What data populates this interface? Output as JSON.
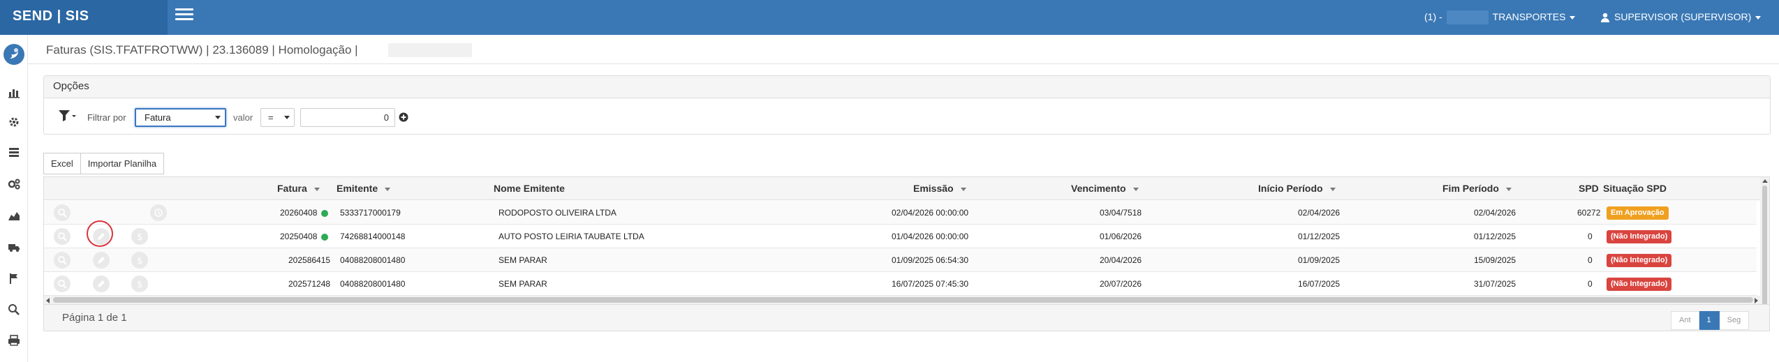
{
  "app": {
    "brand": "SEND | SIS"
  },
  "topbar": {
    "company_prefix": "(1) -",
    "company_name": "TRANSPORTES",
    "user": "SUPERVISOR (SUPERVISOR)"
  },
  "header": {
    "title": "Faturas (SIS.TFATFROTWW) | 23.136089 | Homologação |"
  },
  "options": {
    "title": "Opções",
    "filter_label": "Filtrar por",
    "filter_field": "Fatura",
    "valor_label": "valor",
    "operator": "=",
    "value": "0"
  },
  "toolbar": {
    "excel": "Excel",
    "import": "Importar Planilha"
  },
  "table": {
    "columns": [
      "Fatura",
      "Emitente",
      "Nome Emitente",
      "Emissão",
      "Vencimento",
      "Início Período",
      "Fim Período",
      "SPD",
      "Situação SPD"
    ],
    "rows": [
      {
        "fatura": "20260408",
        "emitente": "5333717000179",
        "nome": "RODOPOSTO OLIVEIRA LTDA",
        "emissao": "02/04/2026 00:00:00",
        "vencimento": "03/04/7518",
        "inicio": "02/04/2026",
        "fim": "02/04/2026",
        "spd": "60272",
        "situacao": "Em Aprovação",
        "situacao_color": "#f0a020",
        "status_dot": true
      },
      {
        "fatura": "20250408",
        "emitente": "74268814000148",
        "nome": "AUTO POSTO LEIRIA TAUBATE LTDA",
        "emissao": "01/04/2026 00:00:00",
        "vencimento": "01/06/2026",
        "inicio": "01/12/2025",
        "fim": "01/12/2025",
        "spd": "0",
        "situacao": "(Não Integrado)",
        "situacao_color": "#d9443f",
        "status_dot": true
      },
      {
        "fatura": "202586415",
        "emitente": "04088208001480",
        "nome": "SEM PARAR",
        "emissao": "01/09/2025 06:54:30",
        "vencimento": "20/04/2026",
        "inicio": "01/09/2025",
        "fim": "15/09/2025",
        "spd": "0",
        "situacao": "(Não Integrado)",
        "situacao_color": "#d9443f",
        "status_dot": false
      },
      {
        "fatura": "202571248",
        "emitente": "04088208001480",
        "nome": "SEM PARAR",
        "emissao": "16/07/2025 07:45:30",
        "vencimento": "20/07/2026",
        "inicio": "16/07/2025",
        "fim": "31/07/2025",
        "spd": "0",
        "situacao": "(Não Integrado)",
        "situacao_color": "#d9443f",
        "status_dot": false
      }
    ]
  },
  "footer": {
    "page_info": "Página 1 de 1",
    "prev": "Ant",
    "current": "1",
    "next": "Seg"
  },
  "colors": {
    "topbar": "#3a78b5",
    "brand_bg": "#2b67a3",
    "accent": "#3b76bf"
  }
}
